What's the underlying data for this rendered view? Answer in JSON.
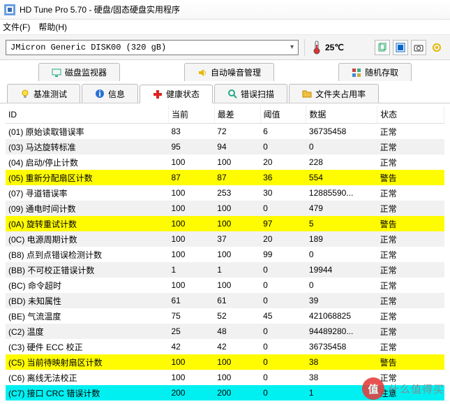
{
  "window": {
    "title": "HD Tune Pro 5.70 - 硬盘/固态硬盘实用程序"
  },
  "menu": {
    "file": "文件(F)",
    "help": "帮助(H)"
  },
  "toolbar": {
    "drive": "JMicron Generic DISK00 (320 gB)",
    "temp": "25℃"
  },
  "tabs_row1": [
    {
      "label": "磁盘监视器",
      "icon": "monitor-icon"
    },
    {
      "label": "自动噪音管理",
      "icon": "speaker-icon"
    },
    {
      "label": "随机存取",
      "icon": "random-icon"
    }
  ],
  "tabs_row2": [
    {
      "label": "基准测试",
      "icon": "bulb-icon"
    },
    {
      "label": "信息",
      "icon": "info-icon"
    },
    {
      "label": "健康状态",
      "icon": "plus-icon",
      "active": true
    },
    {
      "label": "错误扫描",
      "icon": "search-icon"
    },
    {
      "label": "文件夹占用率",
      "icon": "folder-icon"
    }
  ],
  "columns": {
    "id": "ID",
    "current": "当前",
    "worst": "最差",
    "threshold": "阈值",
    "data": "数据",
    "status": "状态"
  },
  "status": {
    "normal": "正常",
    "warning": "警告",
    "attention": "注意"
  },
  "rows": [
    {
      "id": "(01) 原始读取错误率",
      "cur": "83",
      "worst": "72",
      "thr": "6",
      "data": "36735458",
      "st": "normal"
    },
    {
      "id": "(03) 马达旋转标准",
      "cur": "95",
      "worst": "94",
      "thr": "0",
      "data": "0",
      "st": "normal"
    },
    {
      "id": "(04) 启动/停止计数",
      "cur": "100",
      "worst": "100",
      "thr": "20",
      "data": "228",
      "st": "normal"
    },
    {
      "id": "(05) 重新分配扇区计数",
      "cur": "87",
      "worst": "87",
      "thr": "36",
      "data": "554",
      "st": "warning",
      "hl": "yellow"
    },
    {
      "id": "(07) 寻道错误率",
      "cur": "100",
      "worst": "253",
      "thr": "30",
      "data": "12885590...",
      "st": "normal"
    },
    {
      "id": "(09) 通电时间计数",
      "cur": "100",
      "worst": "100",
      "thr": "0",
      "data": "479",
      "st": "normal"
    },
    {
      "id": "(0A) 旋转重试计数",
      "cur": "100",
      "worst": "100",
      "thr": "97",
      "data": "5",
      "st": "warning",
      "hl": "yellow"
    },
    {
      "id": "(0C) 电源周期计数",
      "cur": "100",
      "worst": "37",
      "thr": "20",
      "data": "189",
      "st": "normal"
    },
    {
      "id": "(B8) 点到点错误检测计数",
      "cur": "100",
      "worst": "100",
      "thr": "99",
      "data": "0",
      "st": "normal"
    },
    {
      "id": "(BB) 不可校正错误计数",
      "cur": "1",
      "worst": "1",
      "thr": "0",
      "data": "19944",
      "st": "normal"
    },
    {
      "id": "(BC) 命令超时",
      "cur": "100",
      "worst": "100",
      "thr": "0",
      "data": "0",
      "st": "normal"
    },
    {
      "id": "(BD) 未知属性",
      "cur": "61",
      "worst": "61",
      "thr": "0",
      "data": "39",
      "st": "normal"
    },
    {
      "id": "(BE) 气流温度",
      "cur": "75",
      "worst": "52",
      "thr": "45",
      "data": "421068825",
      "st": "normal"
    },
    {
      "id": "(C2) 温度",
      "cur": "25",
      "worst": "48",
      "thr": "0",
      "data": "94489280...",
      "st": "normal"
    },
    {
      "id": "(C3) 硬件 ECC 校正",
      "cur": "42",
      "worst": "42",
      "thr": "0",
      "data": "36735458",
      "st": "normal"
    },
    {
      "id": "(C5) 当前待映射扇区计数",
      "cur": "100",
      "worst": "100",
      "thr": "0",
      "data": "38",
      "st": "warning",
      "hl": "yellow"
    },
    {
      "id": "(C6) 离线无法校正",
      "cur": "100",
      "worst": "100",
      "thr": "0",
      "data": "38",
      "st": "normal"
    },
    {
      "id": "(C7) 接口 CRC 错误计数",
      "cur": "200",
      "worst": "200",
      "thr": "0",
      "data": "1",
      "st": "attention",
      "hl": "cyan"
    }
  ],
  "watermark": {
    "char": "值",
    "text": "什么值得买"
  }
}
